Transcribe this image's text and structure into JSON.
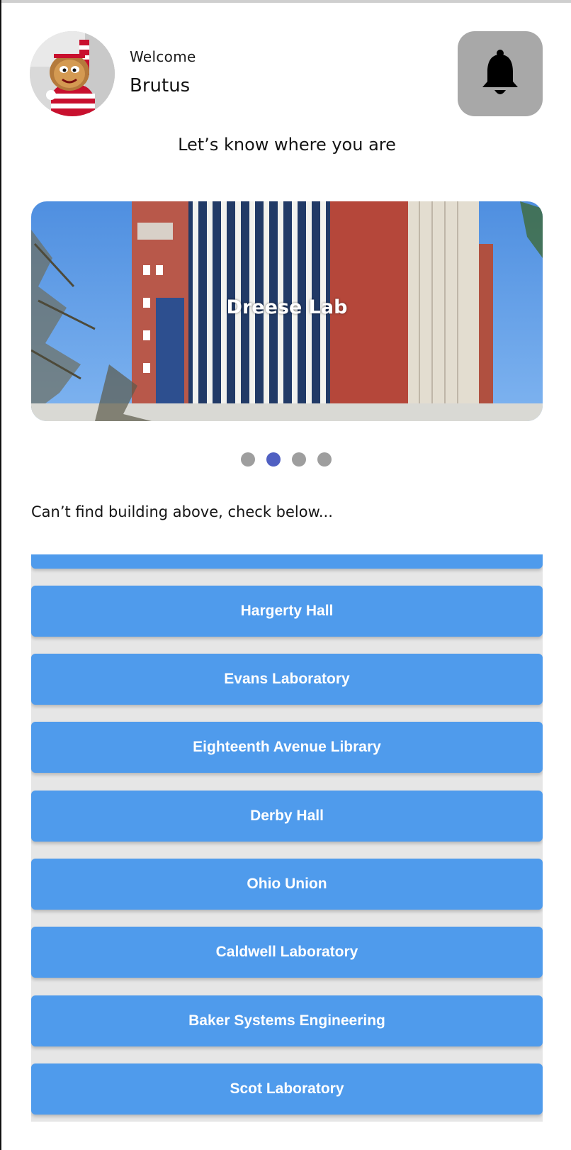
{
  "header": {
    "welcome_label": "Welcome",
    "user_name": "Brutus",
    "avatar_icon": "mascot-avatar",
    "notification_icon": "bell-icon"
  },
  "prompt": "Let’s know where you are",
  "carousel": {
    "caption": "Dreese Lab",
    "total_slides": 4,
    "active_index": 1
  },
  "section_hint": "Can’t find building above, check below...",
  "buildings": [
    {
      "label": "Hargerty Hall"
    },
    {
      "label": "Evans Laboratory"
    },
    {
      "label": "Eighteenth Avenue Library"
    },
    {
      "label": "Derby Hall"
    },
    {
      "label": "Ohio Union"
    },
    {
      "label": "Caldwell Laboratory"
    },
    {
      "label": "Baker Systems Engineering"
    },
    {
      "label": "Scot Laboratory"
    }
  ],
  "colors": {
    "button_blue": "#4f9bec",
    "active_dot": "#5060c2",
    "inactive_dot": "#9e9e9e",
    "bell_bg": "#a8a8a8"
  }
}
